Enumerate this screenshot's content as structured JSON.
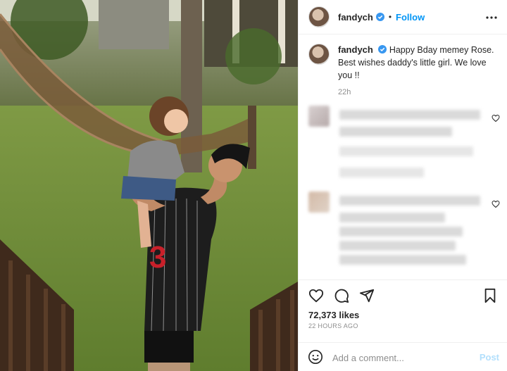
{
  "header": {
    "username": "fandych",
    "follow_label": "Follow",
    "separator": "•"
  },
  "caption": {
    "username": "fandych",
    "text": "Happy Bday memey Rose. Best wishes daddy's little girl. We love you !!",
    "time": "22h"
  },
  "actions": {
    "likes": "72,373 likes",
    "time_ago": "22 HOURS AGO"
  },
  "comment_box": {
    "placeholder": "Add a comment...",
    "post_label": "Post"
  },
  "colors": {
    "accent": "#0095f6",
    "post_disabled": "#b2dffc",
    "verified": "#3897f0",
    "secondary_text": "#8e8e8e"
  },
  "icons": [
    "verified-badge-icon",
    "more-options-icon",
    "heart-icon",
    "comment-icon",
    "share-icon",
    "bookmark-icon",
    "emoji-icon"
  ]
}
